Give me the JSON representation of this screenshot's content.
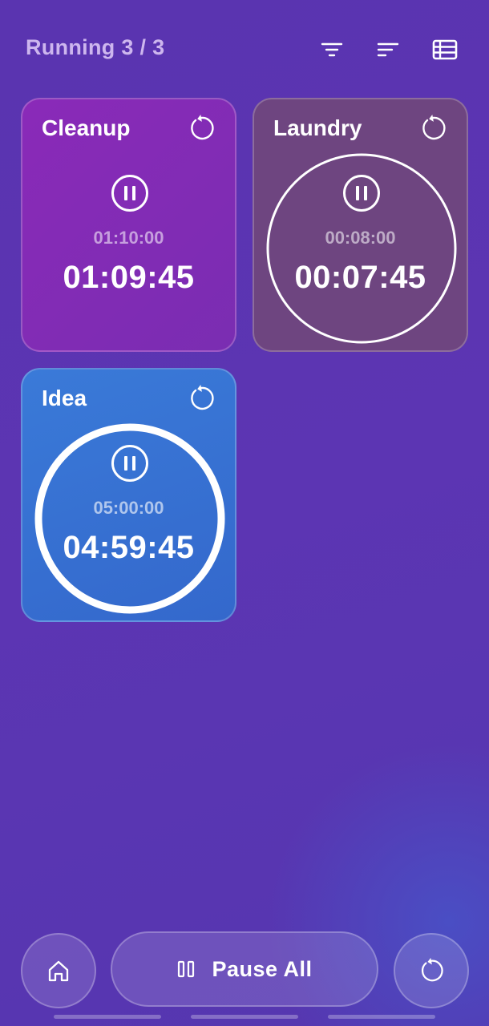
{
  "header": {
    "title": "Running 3 / 3",
    "actions": [
      {
        "icon": "filter-icon"
      },
      {
        "icon": "sort-icon"
      },
      {
        "icon": "table-view-icon"
      }
    ]
  },
  "timers": [
    {
      "name": "Cleanup",
      "target": "01:10:00",
      "remaining": "01:09:45",
      "color": "#8a2ab8",
      "progress_ring": false
    },
    {
      "name": "Laundry",
      "target": "00:08:00",
      "remaining": "00:07:45",
      "color": "#704078",
      "progress_ring": true
    },
    {
      "name": "Idea",
      "target": "05:00:00",
      "remaining": "04:59:45",
      "color": "#3a78d6",
      "progress_ring": true
    }
  ],
  "bottom_bar": {
    "home_icon": "home-icon",
    "pause_all_label": "Pause All",
    "pause_all_icon": "pause-icon",
    "reset_all_icon": "reset-icon"
  }
}
